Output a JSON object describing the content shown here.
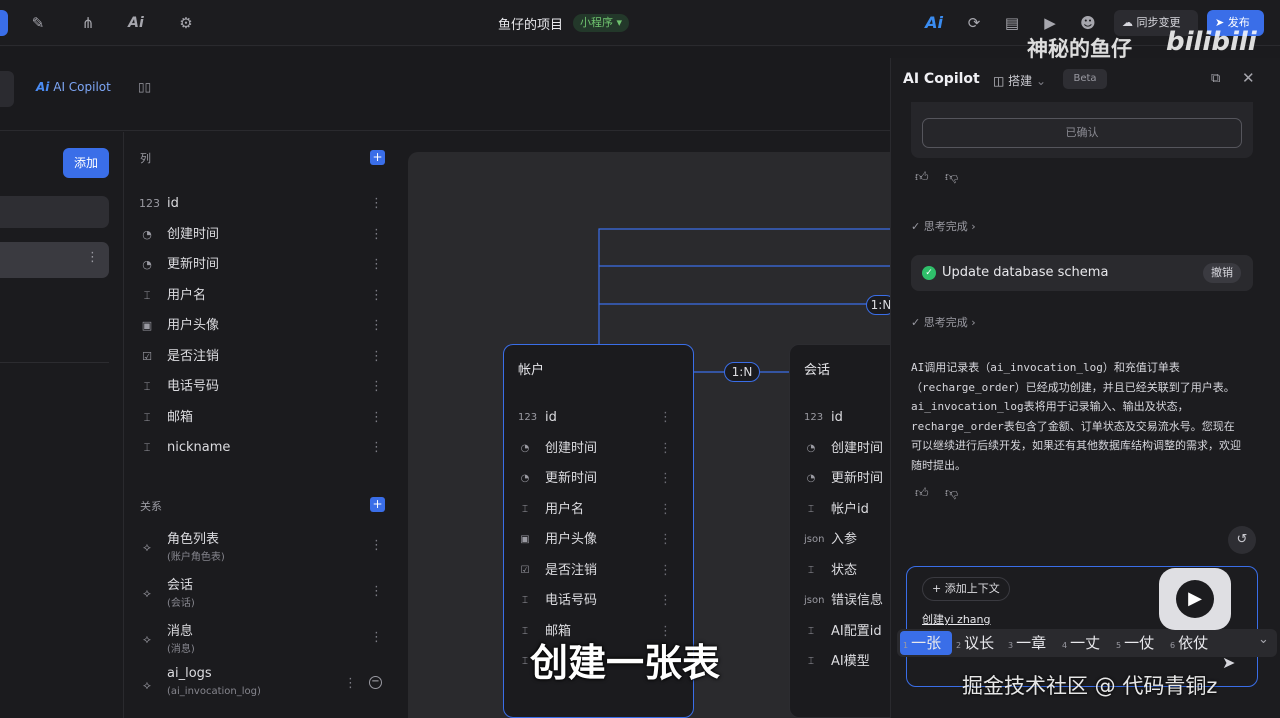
{
  "topbar": {
    "project_title": "鱼仔的项目",
    "project_badge": "小程序",
    "sync_label": "同步变更",
    "publish_label": "发布",
    "icons": [
      "plug-icon",
      "flow-icon",
      "ai-icon",
      "gear-icon"
    ]
  },
  "watermarks": {
    "top_right": "神秘的鱼仔",
    "bilibili": "bilibili",
    "subtitle": "创建一张表",
    "bottom_right": "掘金技术社区 @ 代码青铜z"
  },
  "subheader": {
    "copilot_label": "AI Copilot"
  },
  "left": {
    "add_button": "添加"
  },
  "columns_panel": {
    "header": "列",
    "columns": [
      {
        "icon": "123",
        "name": "id"
      },
      {
        "icon": "◔",
        "name": "创建时间"
      },
      {
        "icon": "◔",
        "name": "更新时间"
      },
      {
        "icon": "⌶",
        "name": "用户名"
      },
      {
        "icon": "▣",
        "name": "用户头像"
      },
      {
        "icon": "☑",
        "name": "是否注销"
      },
      {
        "icon": "⌶",
        "name": "电话号码"
      },
      {
        "icon": "⌶",
        "name": "邮箱"
      },
      {
        "icon": "⌶",
        "name": "nickname"
      }
    ],
    "relations_header": "关系",
    "relations": [
      {
        "name": "角色列表",
        "sub": "(账户角色表)"
      },
      {
        "name": "会话",
        "sub": "(会话)"
      },
      {
        "name": "消息",
        "sub": "(消息)"
      },
      {
        "name": "ai_logs",
        "sub": "(ai_invocation_log)"
      }
    ]
  },
  "canvas": {
    "table1": {
      "title": "帐户",
      "fields": [
        {
          "icon": "123",
          "name": "id"
        },
        {
          "icon": "◔",
          "name": "创建时间"
        },
        {
          "icon": "◔",
          "name": "更新时间"
        },
        {
          "icon": "⌶",
          "name": "用户名"
        },
        {
          "icon": "▣",
          "name": "用户头像"
        },
        {
          "icon": "☑",
          "name": "是否注销"
        },
        {
          "icon": "⌶",
          "name": "电话号码"
        },
        {
          "icon": "⌶",
          "name": "邮箱"
        },
        {
          "icon": "⌶",
          "name": ""
        }
      ]
    },
    "table2": {
      "title": "会话",
      "fields": [
        {
          "icon": "123",
          "name": "id"
        },
        {
          "icon": "◔",
          "name": "创建时间"
        },
        {
          "icon": "◔",
          "name": "更新时间"
        },
        {
          "icon": "⌶",
          "name": "帐户id"
        },
        {
          "icon": "json",
          "name": "入参"
        },
        {
          "icon": "⌶",
          "name": "状态"
        },
        {
          "icon": "json",
          "name": "错误信息"
        },
        {
          "icon": "⌶",
          "name": "AI配置id"
        },
        {
          "icon": "⌶",
          "name": "AI模型"
        }
      ]
    },
    "rel_badge_main": "1:N",
    "rel_badge_top": "1:N"
  },
  "copilot": {
    "title": "AI Copilot",
    "mode": "搭建",
    "beta": "Beta",
    "confirmed_button": "已确认",
    "thinking_1": "思考完成",
    "action_title": "Update database schema",
    "undo_button": "撤销",
    "thinking_2": "思考完成",
    "message_lines": [
      "AI调用记录表（ai_invocation_log）和充值订单表",
      "（recharge_order）已经成功创建，并且已经关联到了用户表。",
      "ai_invocation_log表将用于记录输入、输出及状态，",
      "recharge_order表包含了金额、订单状态及交易流水号。您现在",
      "可以继续进行后续开发，如果还有其他数据库结构调整的需求，欢迎",
      "随时提出。"
    ],
    "add_context": "添加上下文",
    "input_value": "创建yi zhang",
    "ime_candidates": [
      "一张",
      "议长",
      "一章",
      "一丈",
      "一仗",
      "依仗"
    ]
  },
  "colors": {
    "accent": "#3a6ee8",
    "badge_green": "#6fc36f",
    "success": "#2fbf6a"
  }
}
